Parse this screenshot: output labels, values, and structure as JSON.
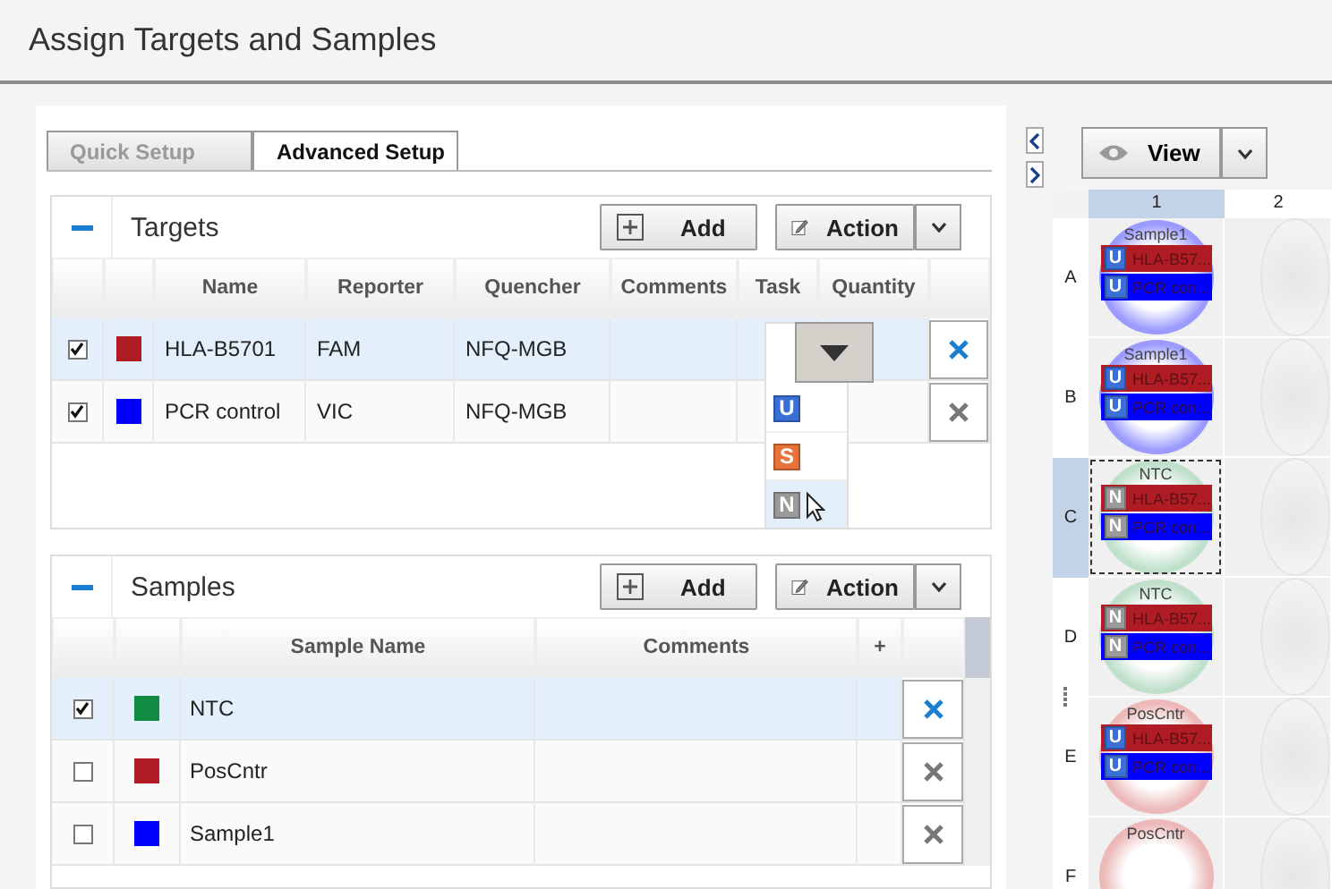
{
  "title": "Assign Targets and Samples",
  "tabs": [
    {
      "label": "Quick Setup",
      "selected": false
    },
    {
      "label": "Advanced Setup",
      "selected": true
    }
  ],
  "targets": {
    "title": "Targets",
    "expanded": true,
    "add": "Add",
    "action": "Action",
    "columns": [
      "Name",
      "Reporter",
      "Quencher",
      "Comments",
      "Task",
      "Quantity"
    ],
    "rows": [
      {
        "checked": true,
        "selected": true,
        "color": "#b01c24",
        "name": "HLA-B5701",
        "reporter": "FAM",
        "quencher": "NFQ-MGB"
      },
      {
        "checked": true,
        "selected": false,
        "color": "#0000ff",
        "name": "PCR control",
        "reporter": "VIC",
        "quencher": "NFQ-MGB"
      }
    ],
    "task_menu": [
      {
        "label": "U",
        "color": "#3a6fd8",
        "selected": false
      },
      {
        "label": "S",
        "color": "#e8733a",
        "selected": false
      },
      {
        "label": "N",
        "color": "#9a9a9a",
        "selected": true
      }
    ]
  },
  "samples": {
    "title": "Samples",
    "expanded": true,
    "add": "Add",
    "action": "Action",
    "columns": [
      "Sample Name",
      "Comments",
      "+"
    ],
    "rows": [
      {
        "checked": true,
        "selected": true,
        "color": "#138a44",
        "name": "NTC"
      },
      {
        "checked": false,
        "selected": false,
        "color": "#b01c24",
        "name": "PosCntr"
      },
      {
        "checked": false,
        "selected": false,
        "color": "#0000ff",
        "name": "Sample1"
      }
    ]
  },
  "plate": {
    "view": "View",
    "columns": [
      {
        "label": "1",
        "selected": true
      },
      {
        "label": "2",
        "selected": false
      }
    ],
    "rows": [
      {
        "label": "A",
        "selected": false,
        "sample": "Sample1",
        "color": "#9a9aff",
        "targets": [
          {
            "task": {
              "label": "U",
              "color": "#3a6fd8"
            },
            "label": "HLA-B57...",
            "color": "#b01c24"
          },
          {
            "task": {
              "label": "U",
              "color": "#3a6fd8"
            },
            "label": "PCR con...",
            "color": "#0000ff"
          }
        ]
      },
      {
        "label": "B",
        "selected": false,
        "sample": "Sample1",
        "color": "#9a9aff",
        "targets": [
          {
            "task": {
              "label": "U",
              "color": "#3a6fd8"
            },
            "label": "HLA-B57...",
            "color": "#b01c24"
          },
          {
            "task": {
              "label": "U",
              "color": "#3a6fd8"
            },
            "label": "PCR con...",
            "color": "#0000ff"
          }
        ]
      },
      {
        "label": "C",
        "selected": true,
        "sample": "NTC",
        "color": "#bfe0cb",
        "targets": [
          {
            "task": {
              "label": "N",
              "color": "#9a9a9a"
            },
            "label": "HLA-B57...",
            "color": "#b01c24"
          },
          {
            "task": {
              "label": "N",
              "color": "#9a9a9a"
            },
            "label": "PCR con...",
            "color": "#0000ff"
          }
        ]
      },
      {
        "label": "D",
        "selected": false,
        "sample": "NTC",
        "color": "#bfe0cb",
        "targets": [
          {
            "task": {
              "label": "N",
              "color": "#9a9a9a"
            },
            "label": "HLA-B57...",
            "color": "#b01c24"
          },
          {
            "task": {
              "label": "N",
              "color": "#9a9a9a"
            },
            "label": "PCR con...",
            "color": "#0000ff"
          }
        ]
      },
      {
        "label": "E",
        "selected": false,
        "sample": "PosCntr",
        "color": "#ecb8b8",
        "targets": [
          {
            "task": {
              "label": "U",
              "color": "#3a6fd8"
            },
            "label": "HLA-B57...",
            "color": "#b01c24"
          },
          {
            "task": {
              "label": "U",
              "color": "#3a6fd8"
            },
            "label": "PCR con...",
            "color": "#0000ff"
          }
        ]
      },
      {
        "label": "F",
        "selected": false,
        "sample": "PosCntr",
        "color": "#ecb8b8",
        "targets": []
      }
    ]
  }
}
